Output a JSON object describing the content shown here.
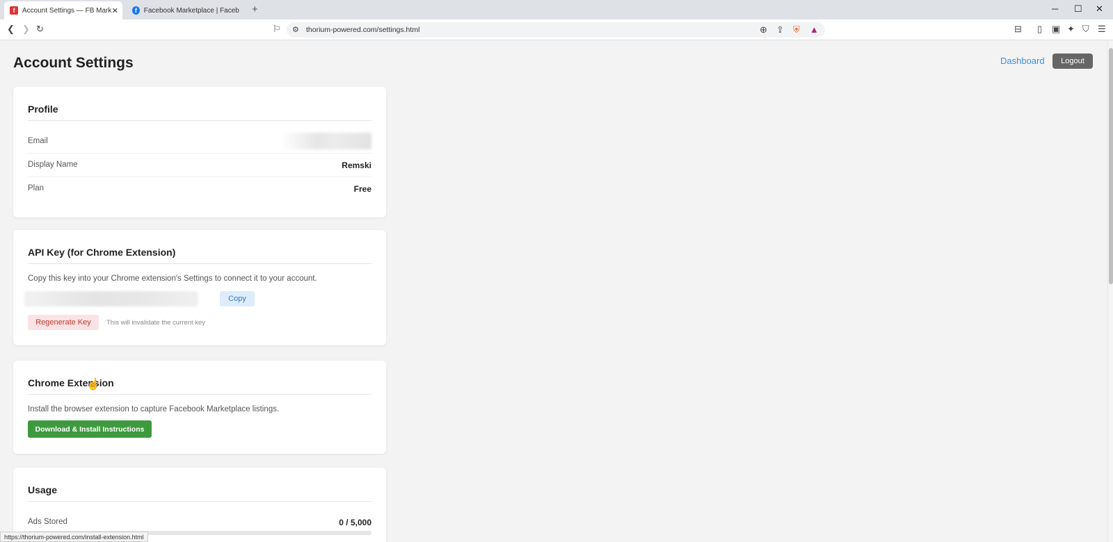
{
  "browser": {
    "tabs": [
      {
        "title": "Account Settings — FB Marketpl",
        "favicon": "f",
        "favicon_color": "#d33"
      },
      {
        "title": "Facebook Marketplace | Facebook",
        "favicon": "f",
        "favicon_color": "#1877f2"
      }
    ],
    "url": "thorium-powered.com/settings.html",
    "status_url": "https://thorium-powered.com/install-extension.html"
  },
  "page": {
    "title": "Account Settings",
    "dashboard_link": "Dashboard",
    "logout_label": "Logout"
  },
  "profile": {
    "title": "Profile",
    "rows": [
      {
        "label": "Email",
        "value": ""
      },
      {
        "label": "Display Name",
        "value": "Remski"
      },
      {
        "label": "Plan",
        "value": "Free"
      }
    ]
  },
  "api_key": {
    "title": "API Key (for Chrome Extension)",
    "description": "Copy this key into your Chrome extension's Settings to connect it to your account.",
    "copy_label": "Copy",
    "regenerate_label": "Regenerate Key",
    "regenerate_note": "This will invalidate the current key"
  },
  "extension": {
    "title": "Chrome Extension",
    "description": "Install the browser extension to capture Facebook Marketplace listings.",
    "download_label": "Download & Install Instructions"
  },
  "usage": {
    "title": "Usage",
    "rows": [
      {
        "label": "Ads Stored",
        "value": "0 / 5,000"
      }
    ]
  },
  "colors": {
    "accent_link": "#3a8fd8",
    "primary_green": "#3f9a3f",
    "danger": "#c0392b"
  }
}
